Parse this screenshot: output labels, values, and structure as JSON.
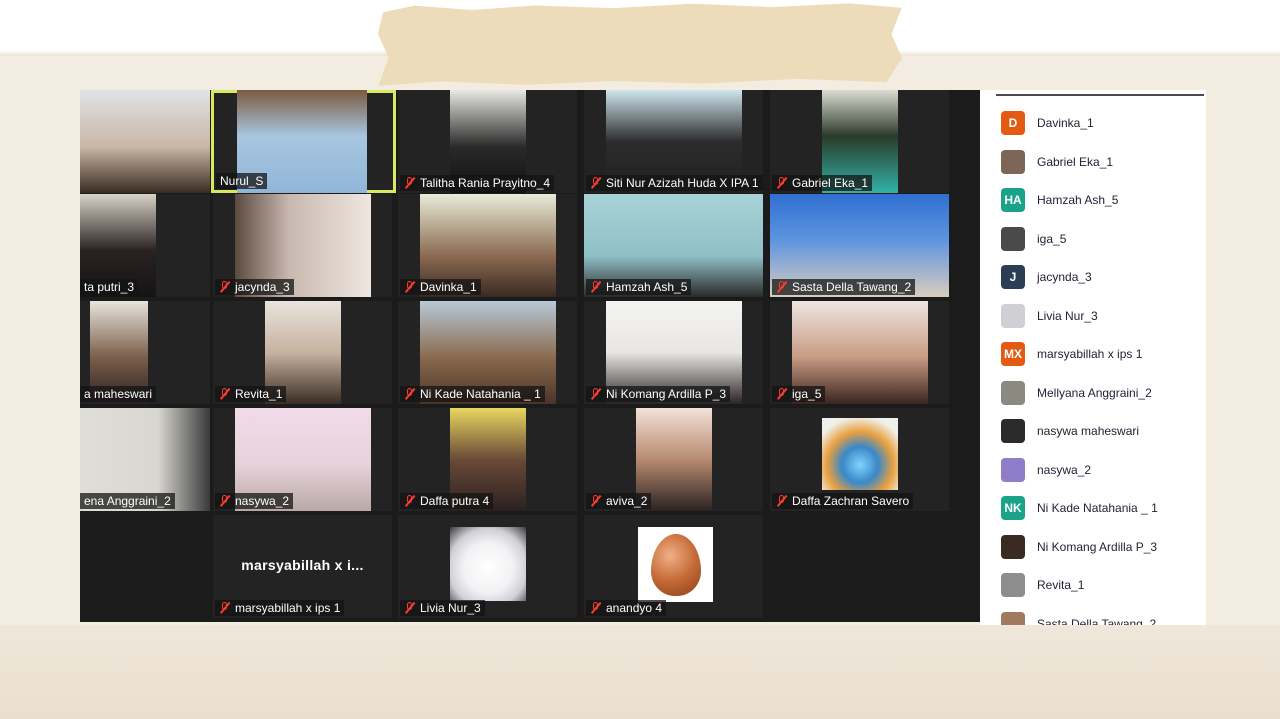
{
  "meeting": {
    "tiles": [
      {
        "name": ""
      },
      {
        "name": "Nurul_S"
      },
      {
        "name": "Talitha Rania Prayitno_4"
      },
      {
        "name": "Siti Nur Azizah Huda X IPA 1"
      },
      {
        "name": "Gabriel Eka_1"
      },
      {
        "name": "ta putri_3"
      },
      {
        "name": "jacynda_3"
      },
      {
        "name": "Davinka_1"
      },
      {
        "name": "Hamzah Ash_5"
      },
      {
        "name": "Sasta Della Tawang_2"
      },
      {
        "name": "a maheswari"
      },
      {
        "name": "Revita_1"
      },
      {
        "name": "Ni Kade Natahania _ 1"
      },
      {
        "name": "Ni Komang Ardilla P_3"
      },
      {
        "name": "iga_5"
      },
      {
        "name": "ena Anggraini_2"
      },
      {
        "name": "nasywa_2"
      },
      {
        "name": "Daffa putra 4"
      },
      {
        "name": "aviva_2"
      },
      {
        "name": "Daffa Zachran Savero"
      },
      {
        "name": "marsyabillah x ips 1",
        "display_text": "marsyabillah x i..."
      },
      {
        "name": "Livia Nur_3"
      },
      {
        "name": "anandyo 4"
      }
    ]
  },
  "participants": [
    {
      "name": "Davinka_1",
      "initials": "D",
      "color": "#e35b12"
    },
    {
      "name": "Gabriel Eka_1",
      "initials": "",
      "color": "#7d6658"
    },
    {
      "name": "Hamzah Ash_5",
      "initials": "HA",
      "color": "#1aa38a"
    },
    {
      "name": "iga_5",
      "initials": "",
      "color": "#4a4a4a"
    },
    {
      "name": "jacynda_3",
      "initials": "J",
      "color": "#2c3e55"
    },
    {
      "name": "Livia Nur_3",
      "initials": "",
      "color": "#cfcfd4"
    },
    {
      "name": "marsyabillah x ips 1",
      "initials": "MX",
      "color": "#e35b12"
    },
    {
      "name": "Mellyana Anggraini_2",
      "initials": "",
      "color": "#8a8a80"
    },
    {
      "name": "nasywa maheswari",
      "initials": "",
      "color": "#2b2b2b"
    },
    {
      "name": "nasywa_2",
      "initials": "",
      "color": "#8e7dc8"
    },
    {
      "name": "Ni Kade Natahania _ 1",
      "initials": "NK",
      "color": "#1aa38a"
    },
    {
      "name": "Ni Komang Ardilla P_3",
      "initials": "",
      "color": "#3a2a22"
    },
    {
      "name": "Revita_1",
      "initials": "",
      "color": "#8d8d8d"
    },
    {
      "name": "Sasta Della Tawang_2",
      "initials": "",
      "color": "#a07a5e"
    }
  ]
}
